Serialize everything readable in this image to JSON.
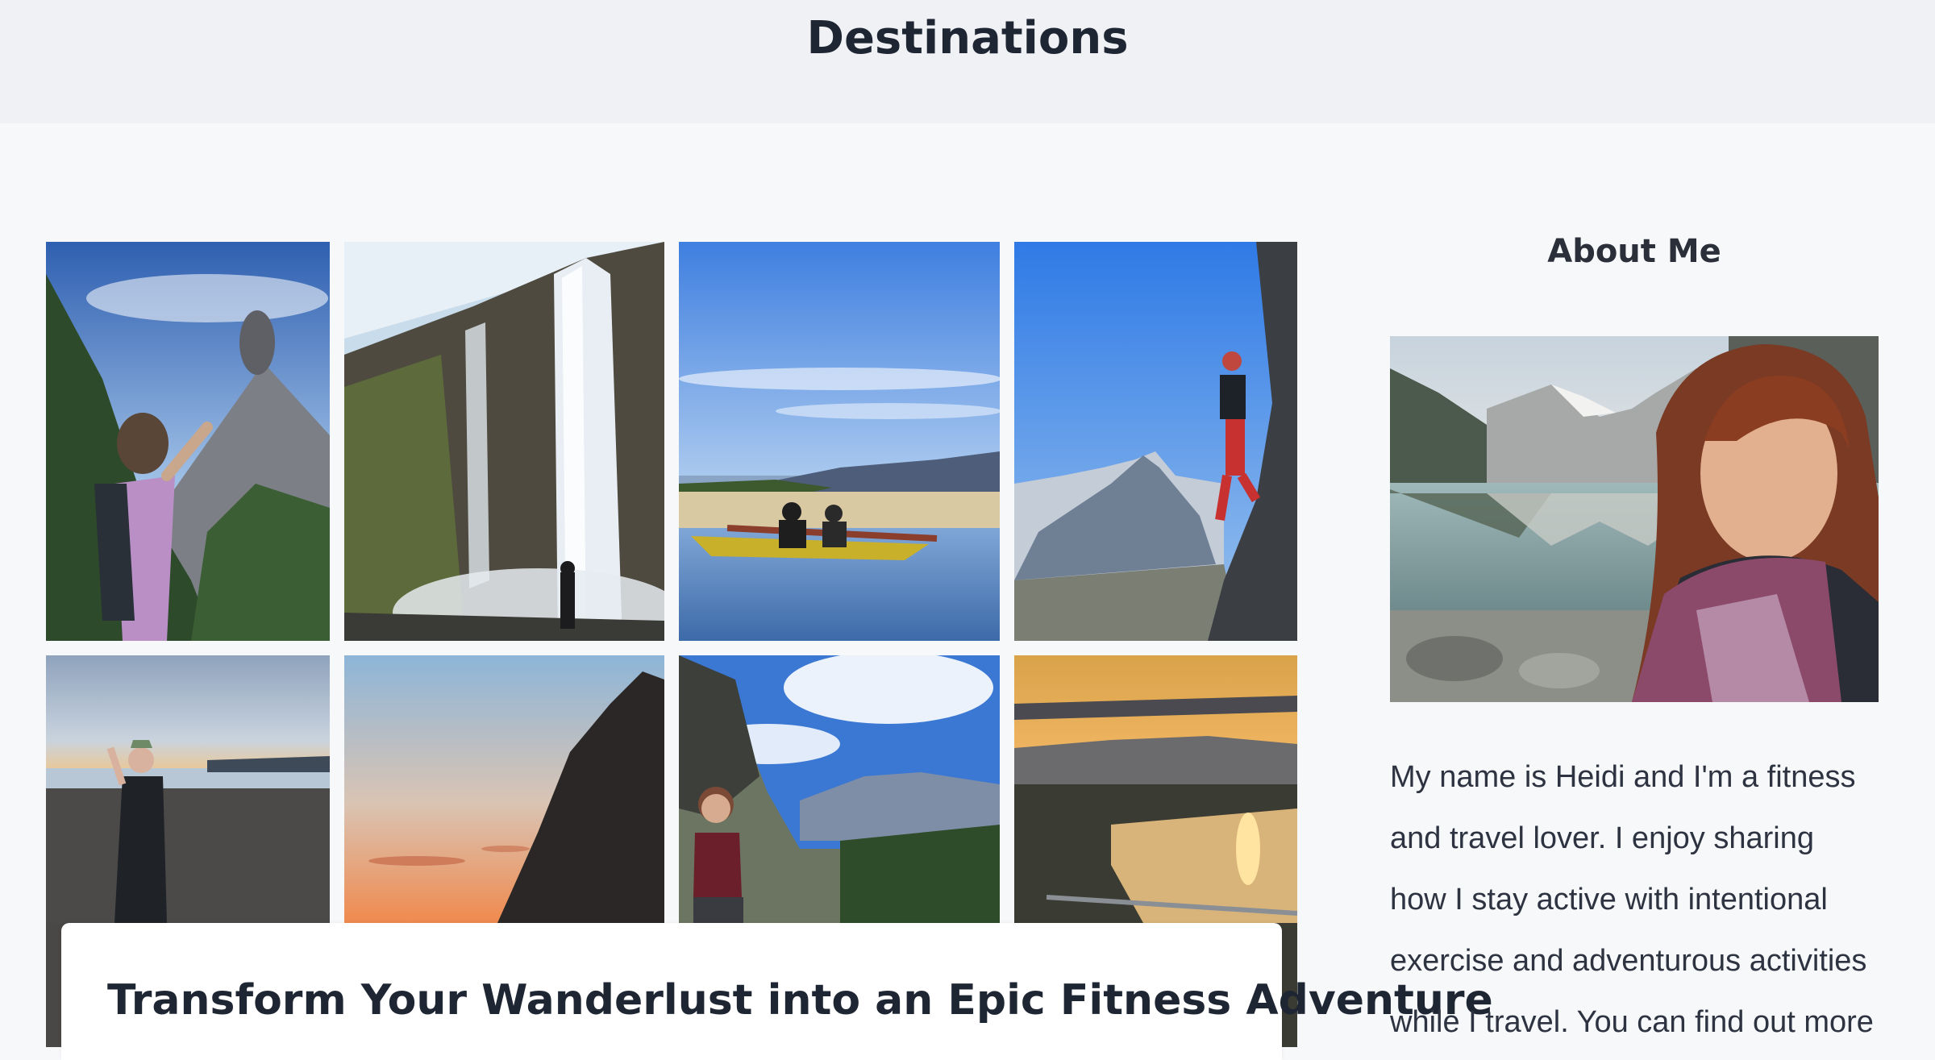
{
  "header": {
    "title": "Destinations"
  },
  "gallery": {
    "photos": [
      {
        "icon": "volcano-hiker-photo"
      },
      {
        "icon": "waterfall-photo"
      },
      {
        "icon": "kayak-lake-photo"
      },
      {
        "icon": "rock-climber-photo"
      },
      {
        "icon": "black-sand-beach-photo"
      },
      {
        "icon": "sunset-cliff-photo"
      },
      {
        "icon": "mountain-meadow-photo"
      },
      {
        "icon": "sunset-fjord-photo"
      }
    ]
  },
  "post": {
    "title": "Transform Your Wanderlust into an Epic Fitness Adventure"
  },
  "sidebar": {
    "heading": "About Me",
    "bio": "My name is Heidi and I'm a fitness and travel lover. I enjoy sharing how I stay active with intentional exercise and adventurous activities while I travel. You can find out more"
  },
  "colors": {
    "header_bg": "#eff1f4",
    "page_bg": "#f7f8fa",
    "text": "#1f2633"
  }
}
